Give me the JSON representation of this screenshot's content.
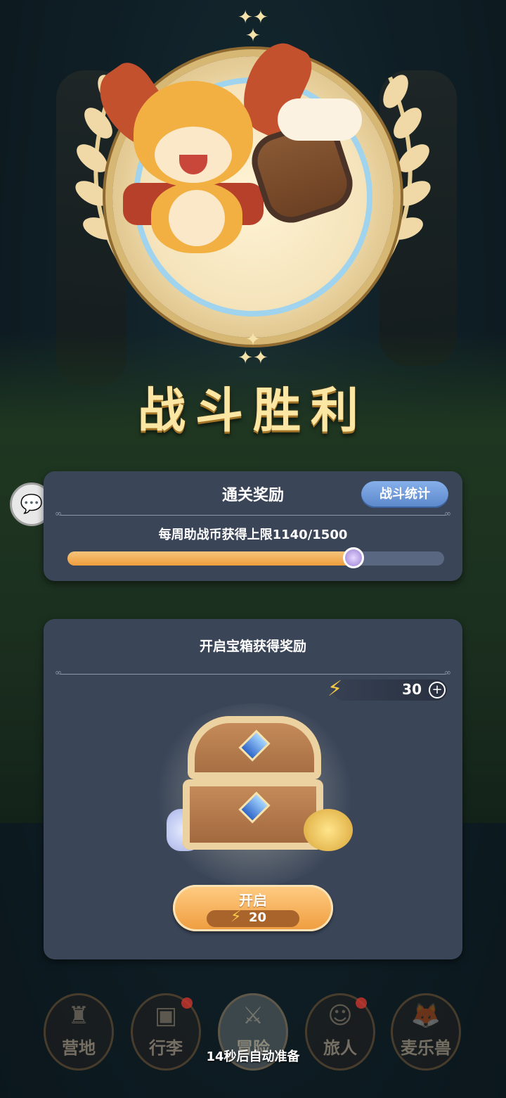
{
  "victory": {
    "title": "战斗胜利"
  },
  "clear_reward": {
    "title": "通关奖励",
    "stats_button": "战斗统计",
    "weekly_limit_text": "每周助战币获得上限1140/1500",
    "progress_fraction": 0.76
  },
  "chest_reward": {
    "title": "开启宝箱获得奖励",
    "energy_value": "30",
    "energy_plus": "+",
    "open_button_label": "开启",
    "open_cost": "20"
  },
  "nav": {
    "items": [
      {
        "label": "营地",
        "icon": "castle-icon",
        "badge": false
      },
      {
        "label": "行李",
        "icon": "backpack-icon",
        "badge": true
      },
      {
        "label": "冒险",
        "icon": "crossed-swords-icon",
        "badge": false
      },
      {
        "label": "旅人",
        "icon": "traveler-icon",
        "badge": true
      },
      {
        "label": "麦乐兽",
        "icon": "fox-icon",
        "badge": false
      }
    ]
  },
  "auto_ready_text": "14秒后自动准备",
  "colors": {
    "accent_orange": "#ef9e3c",
    "card_bg": "#3a4558",
    "title_gold": "#fbe6a3",
    "stat_blue": "#5b86c9"
  }
}
